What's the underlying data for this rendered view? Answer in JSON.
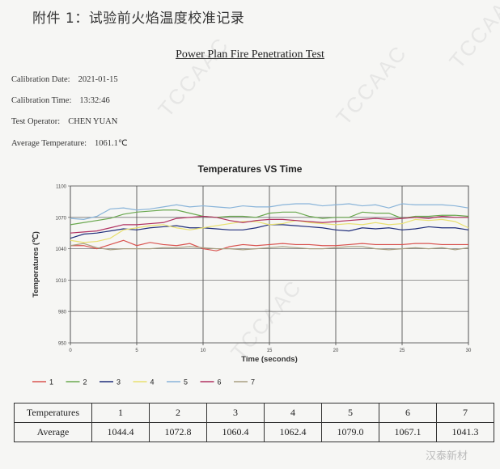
{
  "heading": "附件 1：试验前火焰温度校准记录",
  "report_title": "Power Plan Fire Penetration Test",
  "meta": [
    {
      "label": "Calibration Date:",
      "value": "2021-01-15"
    },
    {
      "label": "Calibration Time:",
      "value": "13:32:46"
    },
    {
      "label": "Test Operator:",
      "value": "CHEN YUAN"
    },
    {
      "label": "Average Temperature:",
      "value": "1061.1℃"
    }
  ],
  "watermark_text": "TCCAAC",
  "footer_watermark": "汉泰新材",
  "chart_data": {
    "type": "line",
    "title": "Temperatures VS Time",
    "xlabel": "Time (seconds)",
    "ylabel": "Temperatures (℃)",
    "xlim": [
      0,
      30
    ],
    "ylim": [
      950,
      1100
    ],
    "xticks": [
      0,
      5,
      10,
      15,
      20,
      25,
      30
    ],
    "yticks": [
      950,
      980,
      1010,
      1040,
      1070,
      1100
    ],
    "grid": true,
    "legend_position": "bottom",
    "x": [
      0,
      1,
      2,
      3,
      4,
      5,
      6,
      7,
      8,
      9,
      10,
      11,
      12,
      13,
      14,
      15,
      16,
      17,
      18,
      19,
      20,
      21,
      22,
      23,
      24,
      25,
      26,
      27,
      28,
      29,
      30
    ],
    "series": [
      {
        "name": "1",
        "color": "#d9534f",
        "values": [
          1043,
          1043,
          1040,
          1044,
          1048,
          1043,
          1046,
          1044,
          1043,
          1045,
          1040,
          1038,
          1042,
          1044,
          1043,
          1044,
          1045,
          1044,
          1044,
          1043,
          1043,
          1044,
          1045,
          1044,
          1044,
          1044,
          1045,
          1045,
          1044,
          1044,
          1044
        ]
      },
      {
        "name": "2",
        "color": "#6aa84f",
        "values": [
          1063,
          1065,
          1067,
          1069,
          1073,
          1075,
          1076,
          1077,
          1077,
          1074,
          1071,
          1070,
          1071,
          1071,
          1070,
          1074,
          1075,
          1075,
          1071,
          1069,
          1070,
          1070,
          1075,
          1074,
          1074,
          1069,
          1071,
          1071,
          1072,
          1072,
          1071
        ]
      },
      {
        "name": "3",
        "color": "#1f2d7a",
        "values": [
          1050,
          1054,
          1055,
          1057,
          1059,
          1058,
          1060,
          1061,
          1062,
          1060,
          1060,
          1059,
          1058,
          1058,
          1060,
          1063,
          1063,
          1062,
          1061,
          1060,
          1058,
          1057,
          1060,
          1059,
          1060,
          1058,
          1059,
          1061,
          1060,
          1060,
          1058
        ]
      },
      {
        "name": "4",
        "color": "#e8e070",
        "values": [
          1048,
          1046,
          1047,
          1050,
          1058,
          1060,
          1062,
          1063,
          1060,
          1058,
          1060,
          1062,
          1064,
          1066,
          1066,
          1063,
          1064,
          1067,
          1065,
          1064,
          1063,
          1064,
          1063,
          1065,
          1063,
          1064,
          1068,
          1067,
          1068,
          1066,
          1060
        ]
      },
      {
        "name": "5",
        "color": "#89b4d9",
        "values": [
          1069,
          1068,
          1071,
          1078,
          1079,
          1077,
          1078,
          1080,
          1082,
          1080,
          1081,
          1080,
          1079,
          1081,
          1080,
          1080,
          1082,
          1083,
          1083,
          1081,
          1082,
          1083,
          1081,
          1082,
          1079,
          1083,
          1082,
          1082,
          1082,
          1081,
          1079
        ]
      },
      {
        "name": "6",
        "color": "#b03060",
        "values": [
          1055,
          1056,
          1057,
          1060,
          1063,
          1063,
          1064,
          1065,
          1069,
          1070,
          1071,
          1070,
          1067,
          1065,
          1067,
          1068,
          1068,
          1067,
          1066,
          1065,
          1066,
          1067,
          1068,
          1069,
          1068,
          1069,
          1070,
          1069,
          1071,
          1070,
          1070
        ]
      },
      {
        "name": "7",
        "color": "#a89f82",
        "values": [
          1043,
          1045,
          1041,
          1039,
          1040,
          1040,
          1040,
          1041,
          1041,
          1042,
          1041,
          1040,
          1040,
          1039,
          1040,
          1041,
          1042,
          1041,
          1040,
          1040,
          1041,
          1042,
          1042,
          1040,
          1039,
          1040,
          1041,
          1040,
          1041,
          1039,
          1041
        ]
      }
    ],
    "table": {
      "row_headers": [
        "Temperatures",
        "Average"
      ],
      "columns": [
        "1",
        "2",
        "3",
        "4",
        "5",
        "6",
        "7"
      ],
      "averages": [
        "1044.4",
        "1072.8",
        "1060.4",
        "1062.4",
        "1079.0",
        "1067.1",
        "1041.3"
      ]
    }
  }
}
